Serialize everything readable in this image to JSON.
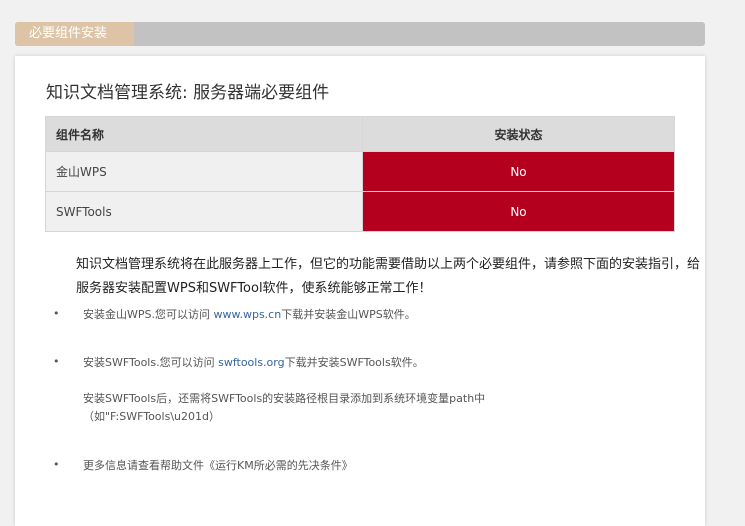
{
  "header": {
    "tab_label": "必要组件安装"
  },
  "main": {
    "title": "知识文档管理系统: 服务器端必要组件",
    "table": {
      "columns": [
        "组件名称",
        "安装状态"
      ],
      "rows": [
        {
          "name": "金山WPS",
          "status": "No"
        },
        {
          "name": "SWFTools",
          "status": "No"
        }
      ]
    },
    "intro": "知识文档管理系统将在此服务器上工作，但它的功能需要借助以上两个必要组件，请参照下面的安装指引，给服务器安装配置WPS和SWFTool软件，使系统能够正常工作！",
    "bullets": [
      {
        "prefix": "安装金山WPS.您可以访问 ",
        "link": "www.wps.cn",
        "suffix": "下载并安装金山WPS软件。"
      },
      {
        "prefix": "安装SWFTools.您可以访问 ",
        "link": "swftools.org",
        "suffix": "下载并安装SWFTools软件。"
      },
      {
        "prefix": "更多信息请查看帮助文件《运行KM所必需的先决条件》",
        "link": "",
        "suffix": ""
      }
    ],
    "note_line1": "安装SWFTools后，还需将SWFTools的安装路径根目录添加到系统环境变量path中",
    "note_line2": "（如\"F:SWFTools\\u201d）",
    "bullet_glyph": "•"
  }
}
